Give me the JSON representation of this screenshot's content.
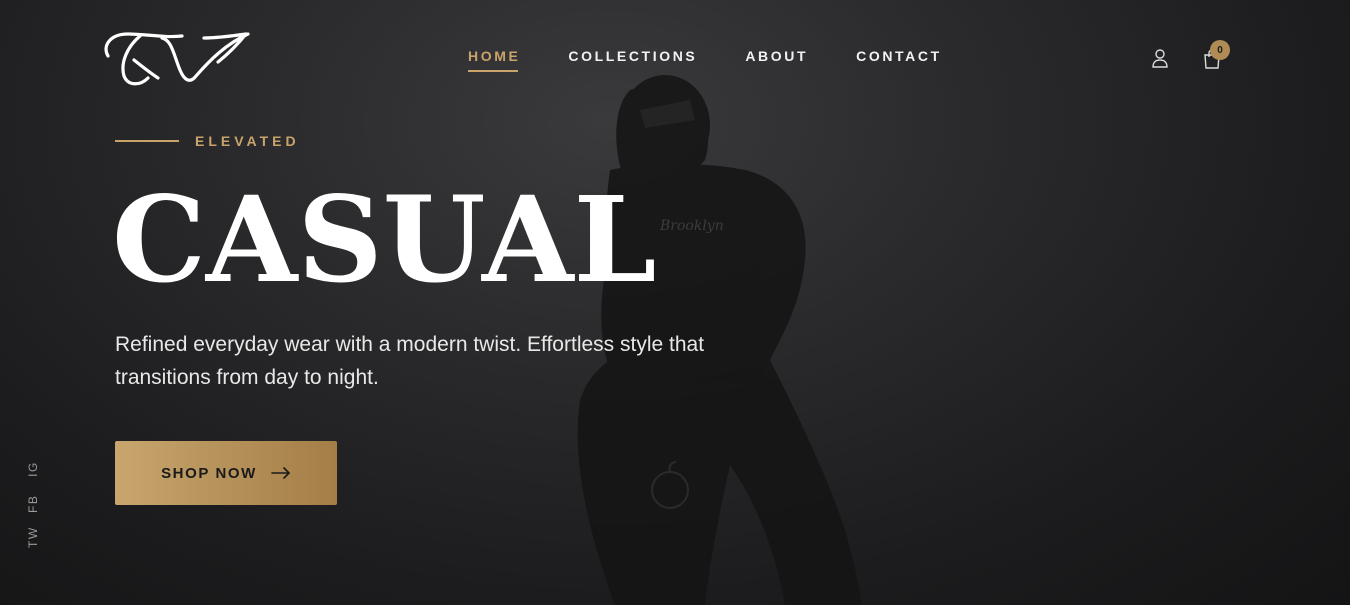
{
  "nav": {
    "items": [
      {
        "label": "HOME",
        "active": true
      },
      {
        "label": "COLLECTIONS",
        "active": false
      },
      {
        "label": "ABOUT",
        "active": false
      },
      {
        "label": "CONTACT",
        "active": false
      }
    ]
  },
  "header": {
    "cart_count": "0",
    "icons": {
      "account": "user-icon",
      "cart": "shopping-bag-icon"
    }
  },
  "hero": {
    "eyebrow": "ELEVATED",
    "headline": "CASUAL",
    "subtitle": "Refined everyday wear with a modern twist. Effortless style that transitions from day to night.",
    "cta_label": "SHOP NOW"
  },
  "social": {
    "links": [
      "IG",
      "FB",
      "TW"
    ]
  },
  "colors": {
    "accent": "#c9a46a",
    "background": "#1e1e20",
    "text": "#ffffff"
  }
}
